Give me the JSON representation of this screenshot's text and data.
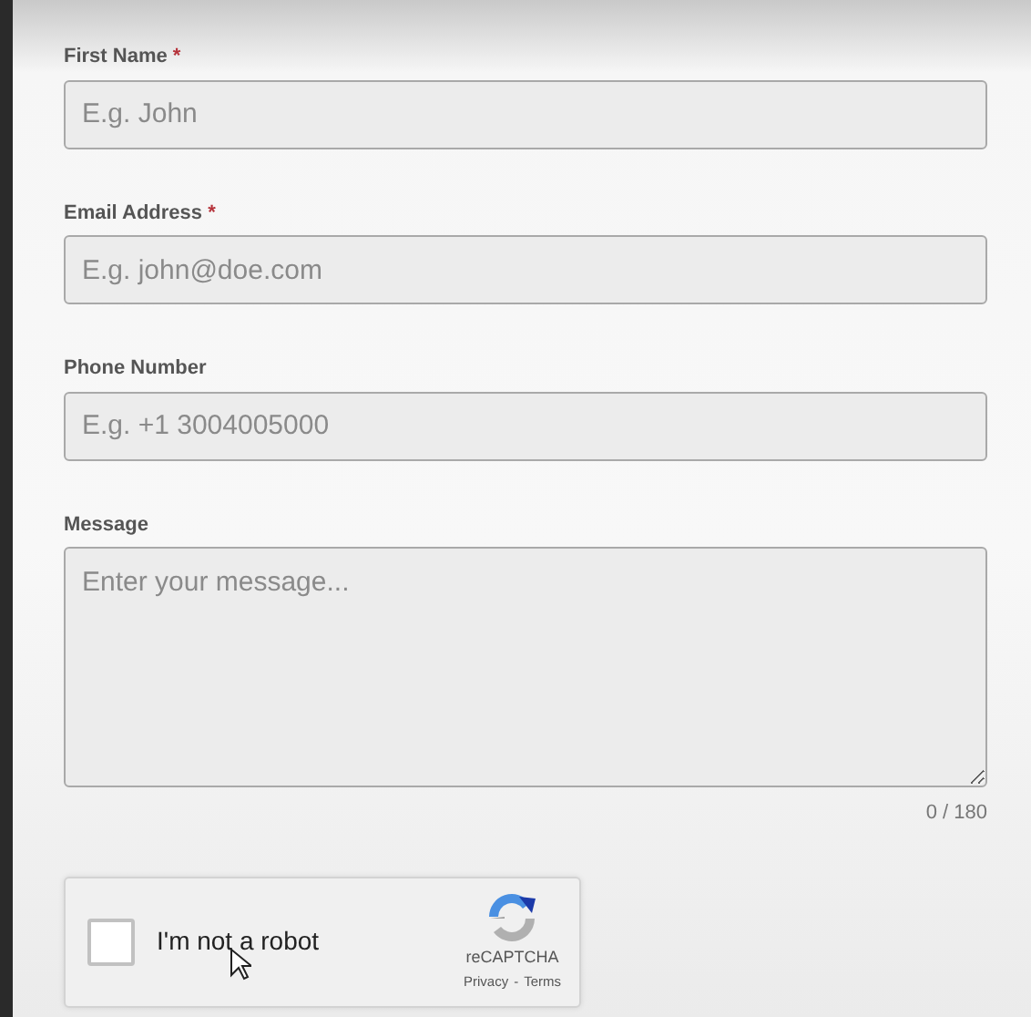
{
  "fields": [
    {
      "label": "First Name",
      "required_mark": "*",
      "kind": "input",
      "placeholder": "E.g. John"
    },
    {
      "label": "Email Address",
      "required_mark": "*",
      "kind": "input",
      "placeholder": "E.g. john@doe.com"
    },
    {
      "label": "Phone Number",
      "kind": "input",
      "placeholder": "E.g. +1 3004005000"
    },
    {
      "label": "Message",
      "kind": "textarea",
      "placeholder": "Enter your message...",
      "counter": "0 / 180"
    }
  ],
  "captcha": {
    "label": "I'm not a robot",
    "checked": false,
    "brand": "reCAPTCHA",
    "links": [
      "Privacy",
      "Terms"
    ],
    "separator": "-"
  }
}
